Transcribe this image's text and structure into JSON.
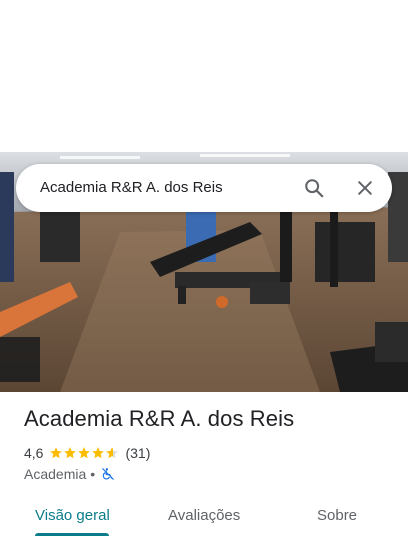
{
  "search": {
    "query": "Academia R&R A. dos Reis"
  },
  "place": {
    "name": "Academia R&R A. dos Reis",
    "rating": "4,6",
    "rating_stars": 4.6,
    "reviews_count": "(31)",
    "category": "Academia",
    "separator": "•",
    "accessibility_icon": "wheelchair-not-accessible-icon"
  },
  "tabs": {
    "overview": "Visão geral",
    "reviews": "Avaliações",
    "about": "Sobre",
    "active": "overview"
  },
  "colors": {
    "accent": "#0b7d8a",
    "star": "#fbbc04",
    "text": "#202124",
    "secondary": "#5f6368",
    "a11y": "#1a73e8"
  }
}
